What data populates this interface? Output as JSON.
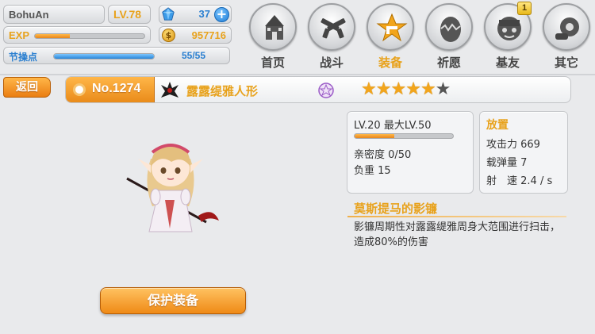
{
  "player": {
    "name": "BohuAn",
    "level": "LV.78",
    "gems": "37",
    "exp_label": "EXP",
    "exp_fraction": 0.32,
    "gold": "957716",
    "gold_symbol": "$",
    "stamina_label": "节操点",
    "stamina_value": "55/55",
    "stamina_fraction": 1.0
  },
  "nav": {
    "items": [
      {
        "label": "首页",
        "icon": "castle-icon"
      },
      {
        "label": "战斗",
        "icon": "crossed-guns-icon"
      },
      {
        "label": "装备",
        "icon": "star-gun-icon"
      },
      {
        "label": "祈愿",
        "icon": "egg-icon"
      },
      {
        "label": "基友",
        "icon": "friend-face-icon",
        "badge": "1"
      },
      {
        "label": "其它",
        "icon": "gear-hand-icon"
      }
    ],
    "active": "装备"
  },
  "back_label": "返回",
  "character": {
    "number": "No.1274",
    "name": "露露缇雅人形",
    "stars_filled": 5,
    "stars_total": 6,
    "star_glyph": "★"
  },
  "stats": {
    "level_text": "LV.20 最大LV.50",
    "level_fraction": 0.4,
    "affection": "亲密度 0/50",
    "weight": "负重 15",
    "type": "放置",
    "attack": "攻击力 669",
    "ammo": "载弹量 7",
    "speed": "射　速 2.4 / s"
  },
  "skill": {
    "title": "莫斯提马的影镰",
    "description": "影镰周期性对露露缇雅周身大范围进行扫击，造成80%的伤害"
  },
  "protect_label": "保护装备",
  "colors": {
    "accent_orange": "#e8a21c",
    "accent_blue": "#2a7fd0",
    "background": "#e9eaec"
  }
}
